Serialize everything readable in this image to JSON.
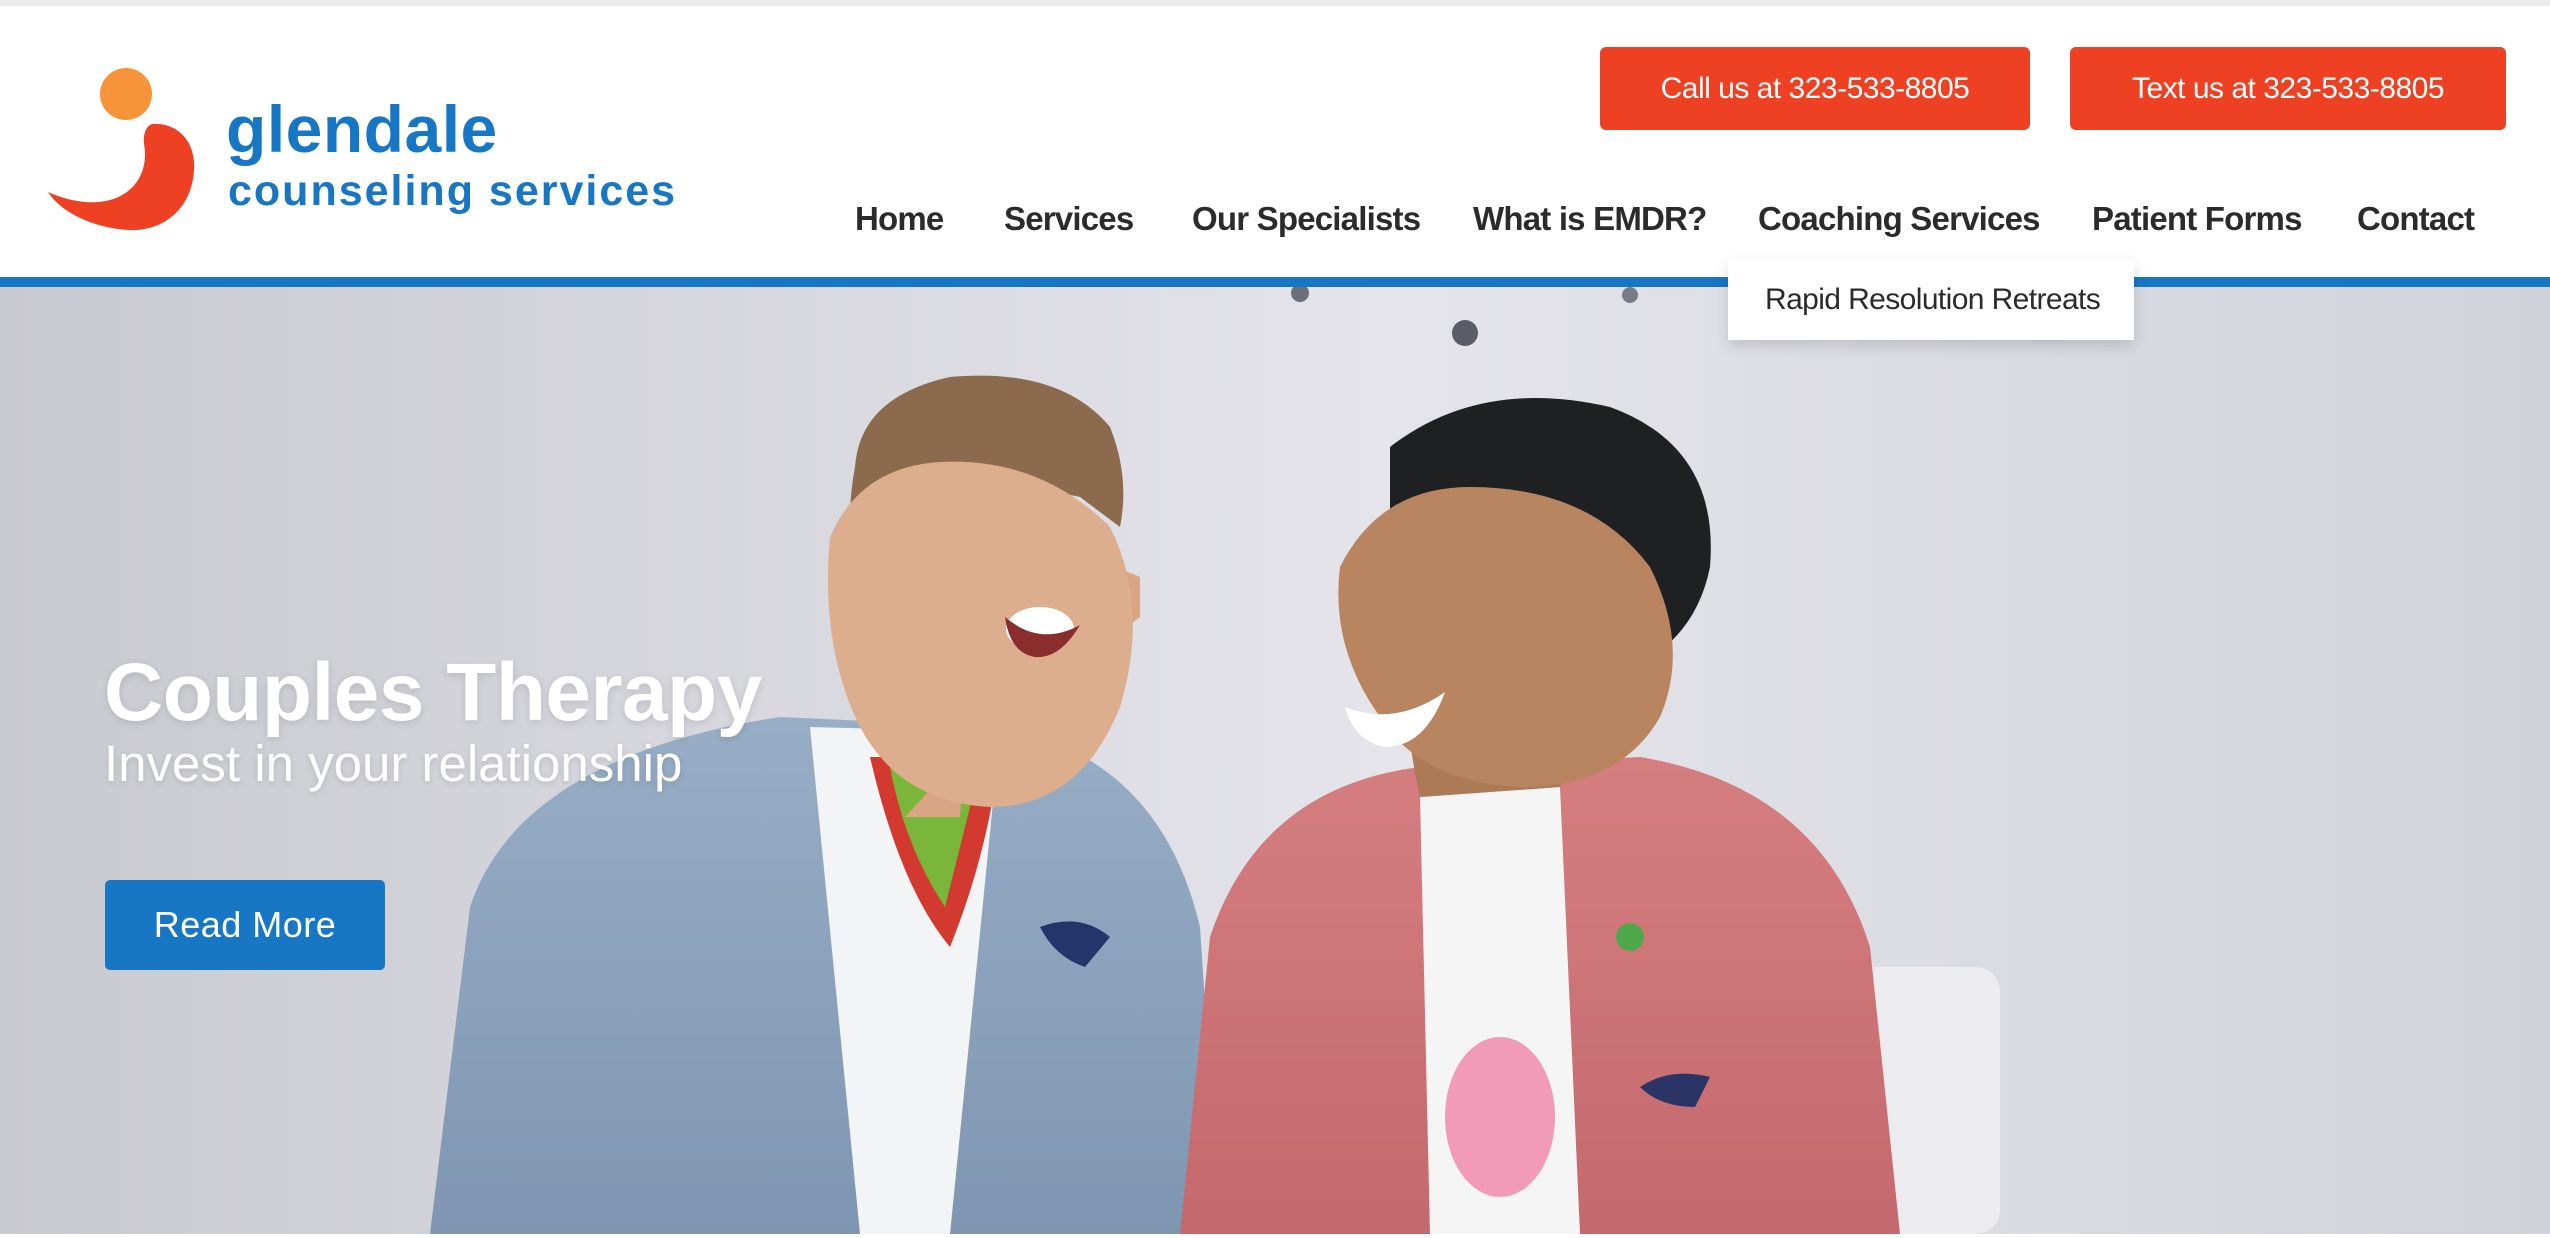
{
  "brand": {
    "name_line1": "glendale",
    "name_line2": "counseling services",
    "logo_icon": "orange-dot-red-swoosh-logo",
    "colors": {
      "primary_blue": "#1777c4",
      "accent_red": "#ee4022",
      "accent_orange": "#f7943a"
    }
  },
  "header": {
    "call_button": "Call us at 323-533-8805",
    "text_button": "Text us at 323-533-8805"
  },
  "nav": {
    "items": [
      {
        "label": "Home"
      },
      {
        "label": "Services"
      },
      {
        "label": "Our Specialists"
      },
      {
        "label": "What is EMDR?"
      },
      {
        "label": "Coaching Services"
      },
      {
        "label": "Patient Forms"
      },
      {
        "label": "Contact"
      }
    ],
    "dropdown": {
      "parent": "Coaching Services",
      "items": [
        {
          "label": "Rapid Resolution Retreats"
        }
      ]
    }
  },
  "hero": {
    "title": "Couples Therapy",
    "subtitle": "Invest in your relationship",
    "button": "Read More",
    "image": "two-men-laughing-photo"
  }
}
